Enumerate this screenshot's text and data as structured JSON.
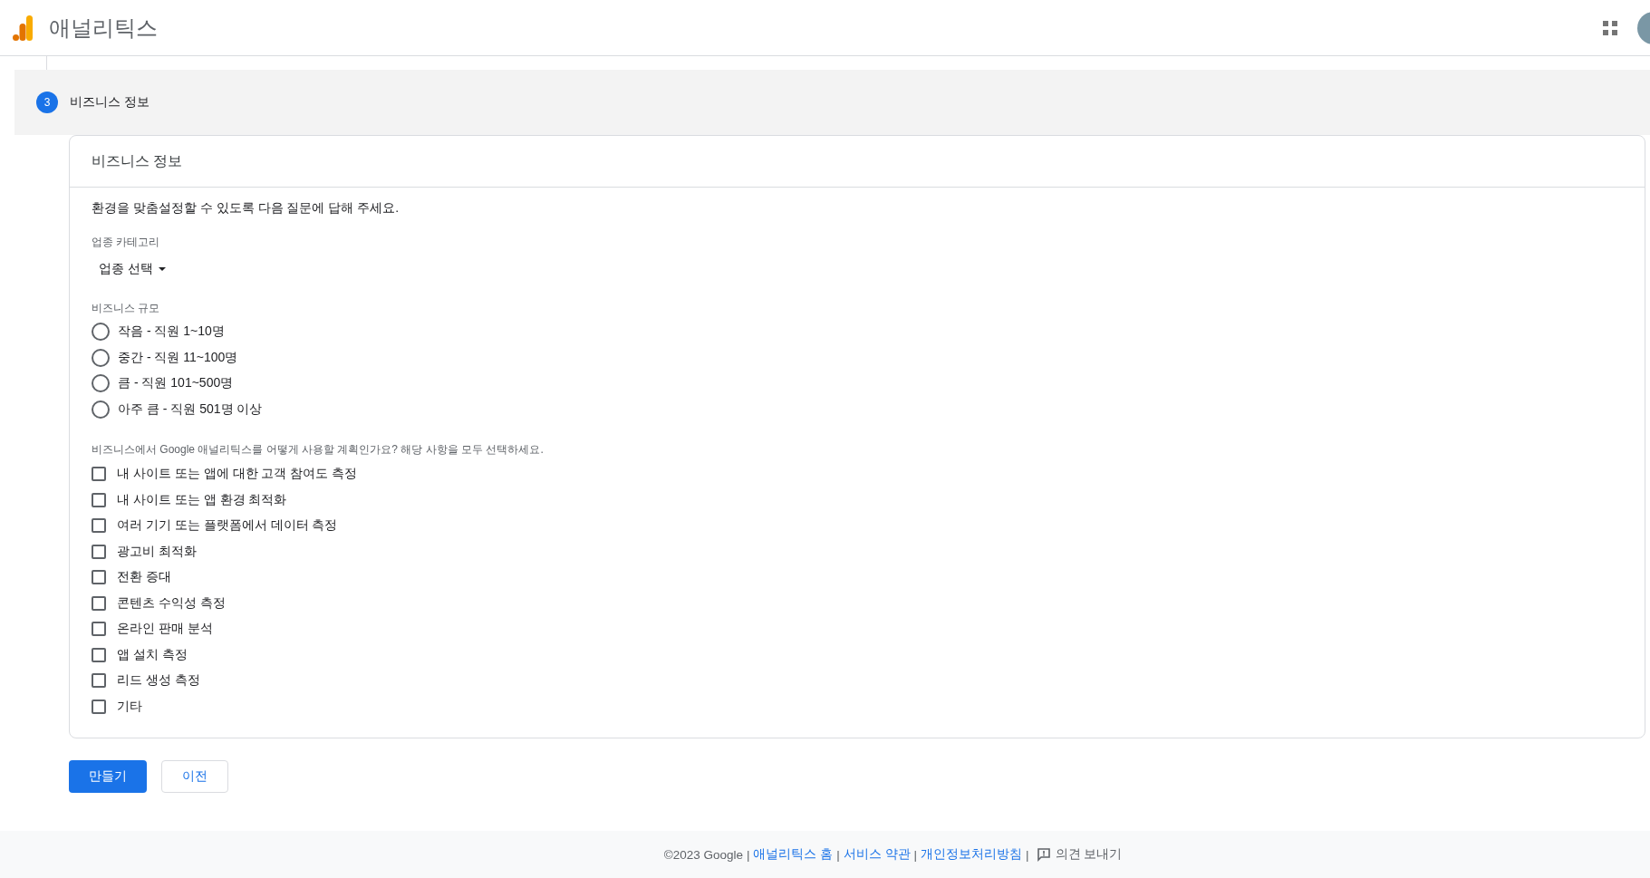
{
  "app_bar": {
    "title": "애널리틱스"
  },
  "step": {
    "number": "3",
    "label": "비즈니스 정보"
  },
  "card": {
    "title": "비즈니스 정보",
    "intro": "환경을 맞춤설정할 수 있도록 다음 질문에 답해 주세요.",
    "industry": {
      "label": "업종 카테고리",
      "value": "업종 선택"
    },
    "size": {
      "label": "비즈니스 규모",
      "options": [
        {
          "label": "작음 - 직원 1~10명",
          "selected": false
        },
        {
          "label": "중간 - 직원 11~100명",
          "selected": false
        },
        {
          "label": "큼 - 직원 101~500명",
          "selected": false
        },
        {
          "label": "아주 큼 - 직원 501명 이상",
          "selected": false
        }
      ]
    },
    "usage": {
      "label": "비즈니스에서 Google 애널리틱스를 어떻게 사용할 계획인가요? 해당 사항을 모두 선택하세요.",
      "options": [
        {
          "label": "내 사이트 또는 앱에 대한 고객 참여도 측정",
          "checked": false
        },
        {
          "label": "내 사이트 또는 앱 환경 최적화",
          "checked": false
        },
        {
          "label": "여러 기기 또는 플랫폼에서 데이터 측정",
          "checked": false
        },
        {
          "label": "광고비 최적화",
          "checked": false
        },
        {
          "label": "전환 증대",
          "checked": false
        },
        {
          "label": "콘텐츠 수익성 측정",
          "checked": false
        },
        {
          "label": "온라인 판매 분석",
          "checked": false
        },
        {
          "label": "앱 설치 측정",
          "checked": false
        },
        {
          "label": "리드 생성 측정",
          "checked": false
        },
        {
          "label": "기타",
          "checked": false
        }
      ]
    }
  },
  "buttons": [
    {
      "label": "만들기",
      "kind": "primary"
    },
    {
      "label": "이전",
      "kind": "secondary"
    }
  ],
  "footer": [
    {
      "kind": "text",
      "text": "©2023 Google"
    },
    {
      "kind": "sep",
      "text": "|"
    },
    {
      "kind": "link",
      "text": "애널리틱스 홈"
    },
    {
      "kind": "sep",
      "text": "|"
    },
    {
      "kind": "link",
      "text": "서비스 약관"
    },
    {
      "kind": "sep",
      "text": "|"
    },
    {
      "kind": "link",
      "text": "개인정보처리방침"
    },
    {
      "kind": "sep",
      "text": "|"
    },
    {
      "kind": "feedback",
      "text": "의견 보내기"
    }
  ]
}
